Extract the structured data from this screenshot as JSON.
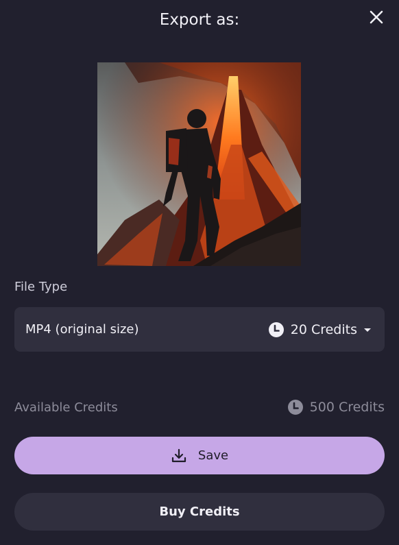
{
  "dialog": {
    "title": "Export as:",
    "close_icon": "close-icon"
  },
  "preview": {
    "image": "volcano-astronaut-preview"
  },
  "file_type": {
    "label": "File Type",
    "selected": "MP4 (original size)",
    "cost": "20 Credits",
    "cost_icon": "credit-icon",
    "dropdown_icon": "caret-down-icon"
  },
  "available_credits": {
    "label": "Available Credits",
    "value": "500 Credits",
    "icon": "credit-icon"
  },
  "save_button": {
    "label": "Save",
    "icon": "download-icon"
  },
  "buy_button": {
    "label": "Buy Credits"
  },
  "colors": {
    "background": "#21202e",
    "surface": "#302f3e",
    "accent": "#c6a7e7",
    "muted_text": "#8d8c9a"
  }
}
